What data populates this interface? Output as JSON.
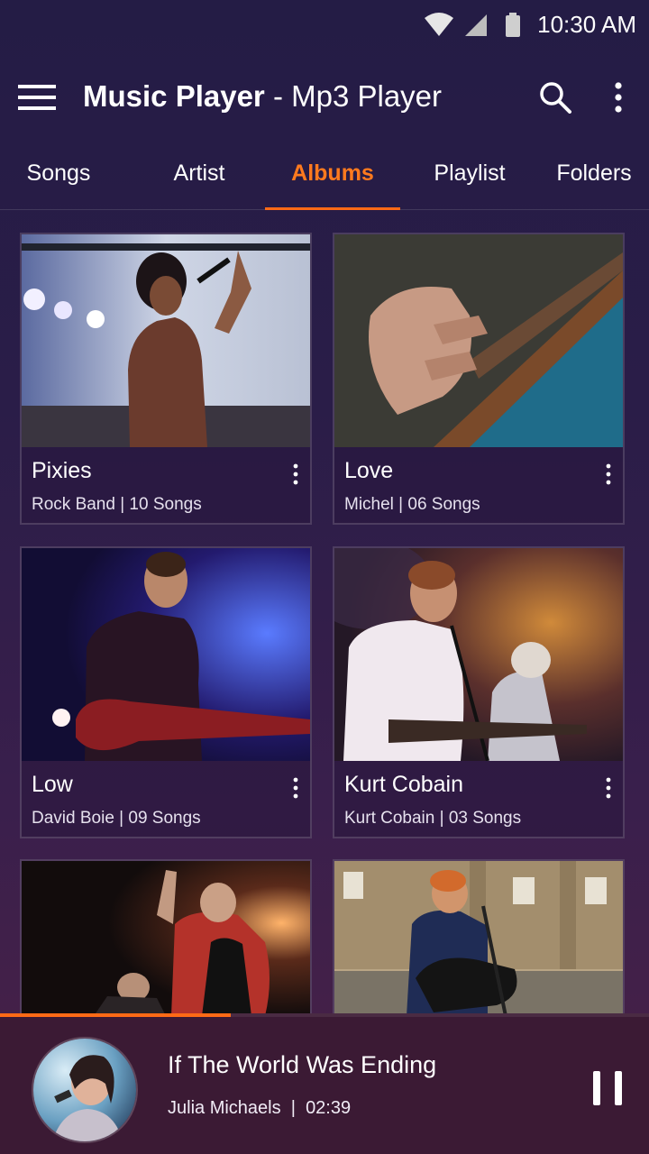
{
  "status": {
    "time": "10:30 AM"
  },
  "app": {
    "title_bold": "Music Player",
    "title_rest": " - Mp3 Player"
  },
  "tabs": [
    {
      "label": "Songs"
    },
    {
      "label": "Artist"
    },
    {
      "label": "Albums"
    },
    {
      "label": "Playlist"
    },
    {
      "label": "Folders"
    }
  ],
  "albums": [
    {
      "title": "Pixies",
      "subtitle": "Rock Band | 10 Songs"
    },
    {
      "title": "Love",
      "subtitle": "Michel | 06 Songs"
    },
    {
      "title": "Low",
      "subtitle": "David Boie | 09 Songs"
    },
    {
      "title": "Kurt Cobain",
      "subtitle": "Kurt Cobain | 03 Songs"
    }
  ],
  "player": {
    "title": "If The World Was Ending",
    "artist": "Julia Michaels",
    "separator": "|",
    "time": "02:39",
    "progress": 0.355
  },
  "colors": {
    "accent": "#ff6a16",
    "active_tab": "#ff7a1e"
  }
}
